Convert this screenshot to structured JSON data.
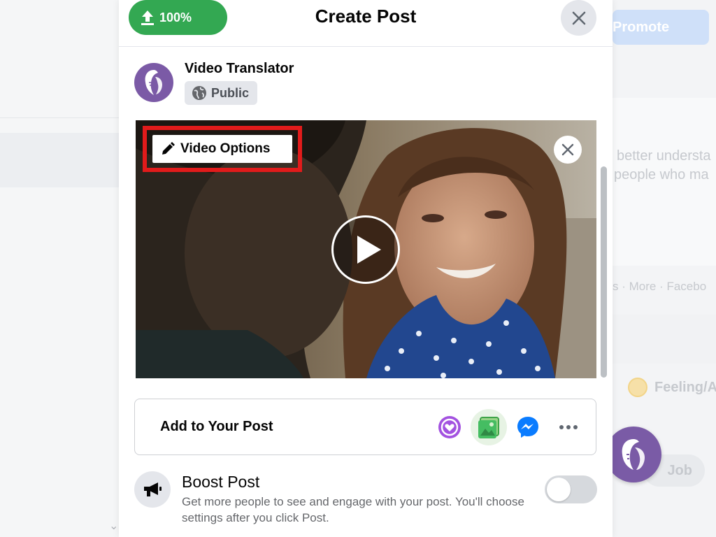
{
  "dialog": {
    "title": "Create Post",
    "upload_progress": "100%",
    "upload_fraction": 1.0,
    "close_icon": "close-icon"
  },
  "author": {
    "name": "Video Translator",
    "audience": "Public",
    "audience_icon": "globe-icon"
  },
  "video": {
    "options_label": "Video Options",
    "options_icon": "pencil-icon",
    "remove_icon": "close-icon",
    "play_icon": "play-icon"
  },
  "add_to_post": {
    "label": "Add to Your Post",
    "icons": [
      "heart-chat-icon",
      "photo-video-icon",
      "messenger-icon",
      "more-icon"
    ]
  },
  "boost": {
    "title": "Boost Post",
    "description": "Get more people to see and engage with your post. You'll choose settings after you click Post.",
    "enabled": false
  },
  "background": {
    "promote_label": "Promote",
    "text_line1": "better understa",
    "text_line2": "people who ma",
    "footer_links": "s · More · Facebo",
    "feeling_label": "Feeling/A",
    "job_label": "Job"
  },
  "colors": {
    "upload_green": "#33a852",
    "highlight_red": "#e21b1b",
    "messenger_blue": "#0a7cff",
    "brand_purple": "#7b5aa6"
  }
}
